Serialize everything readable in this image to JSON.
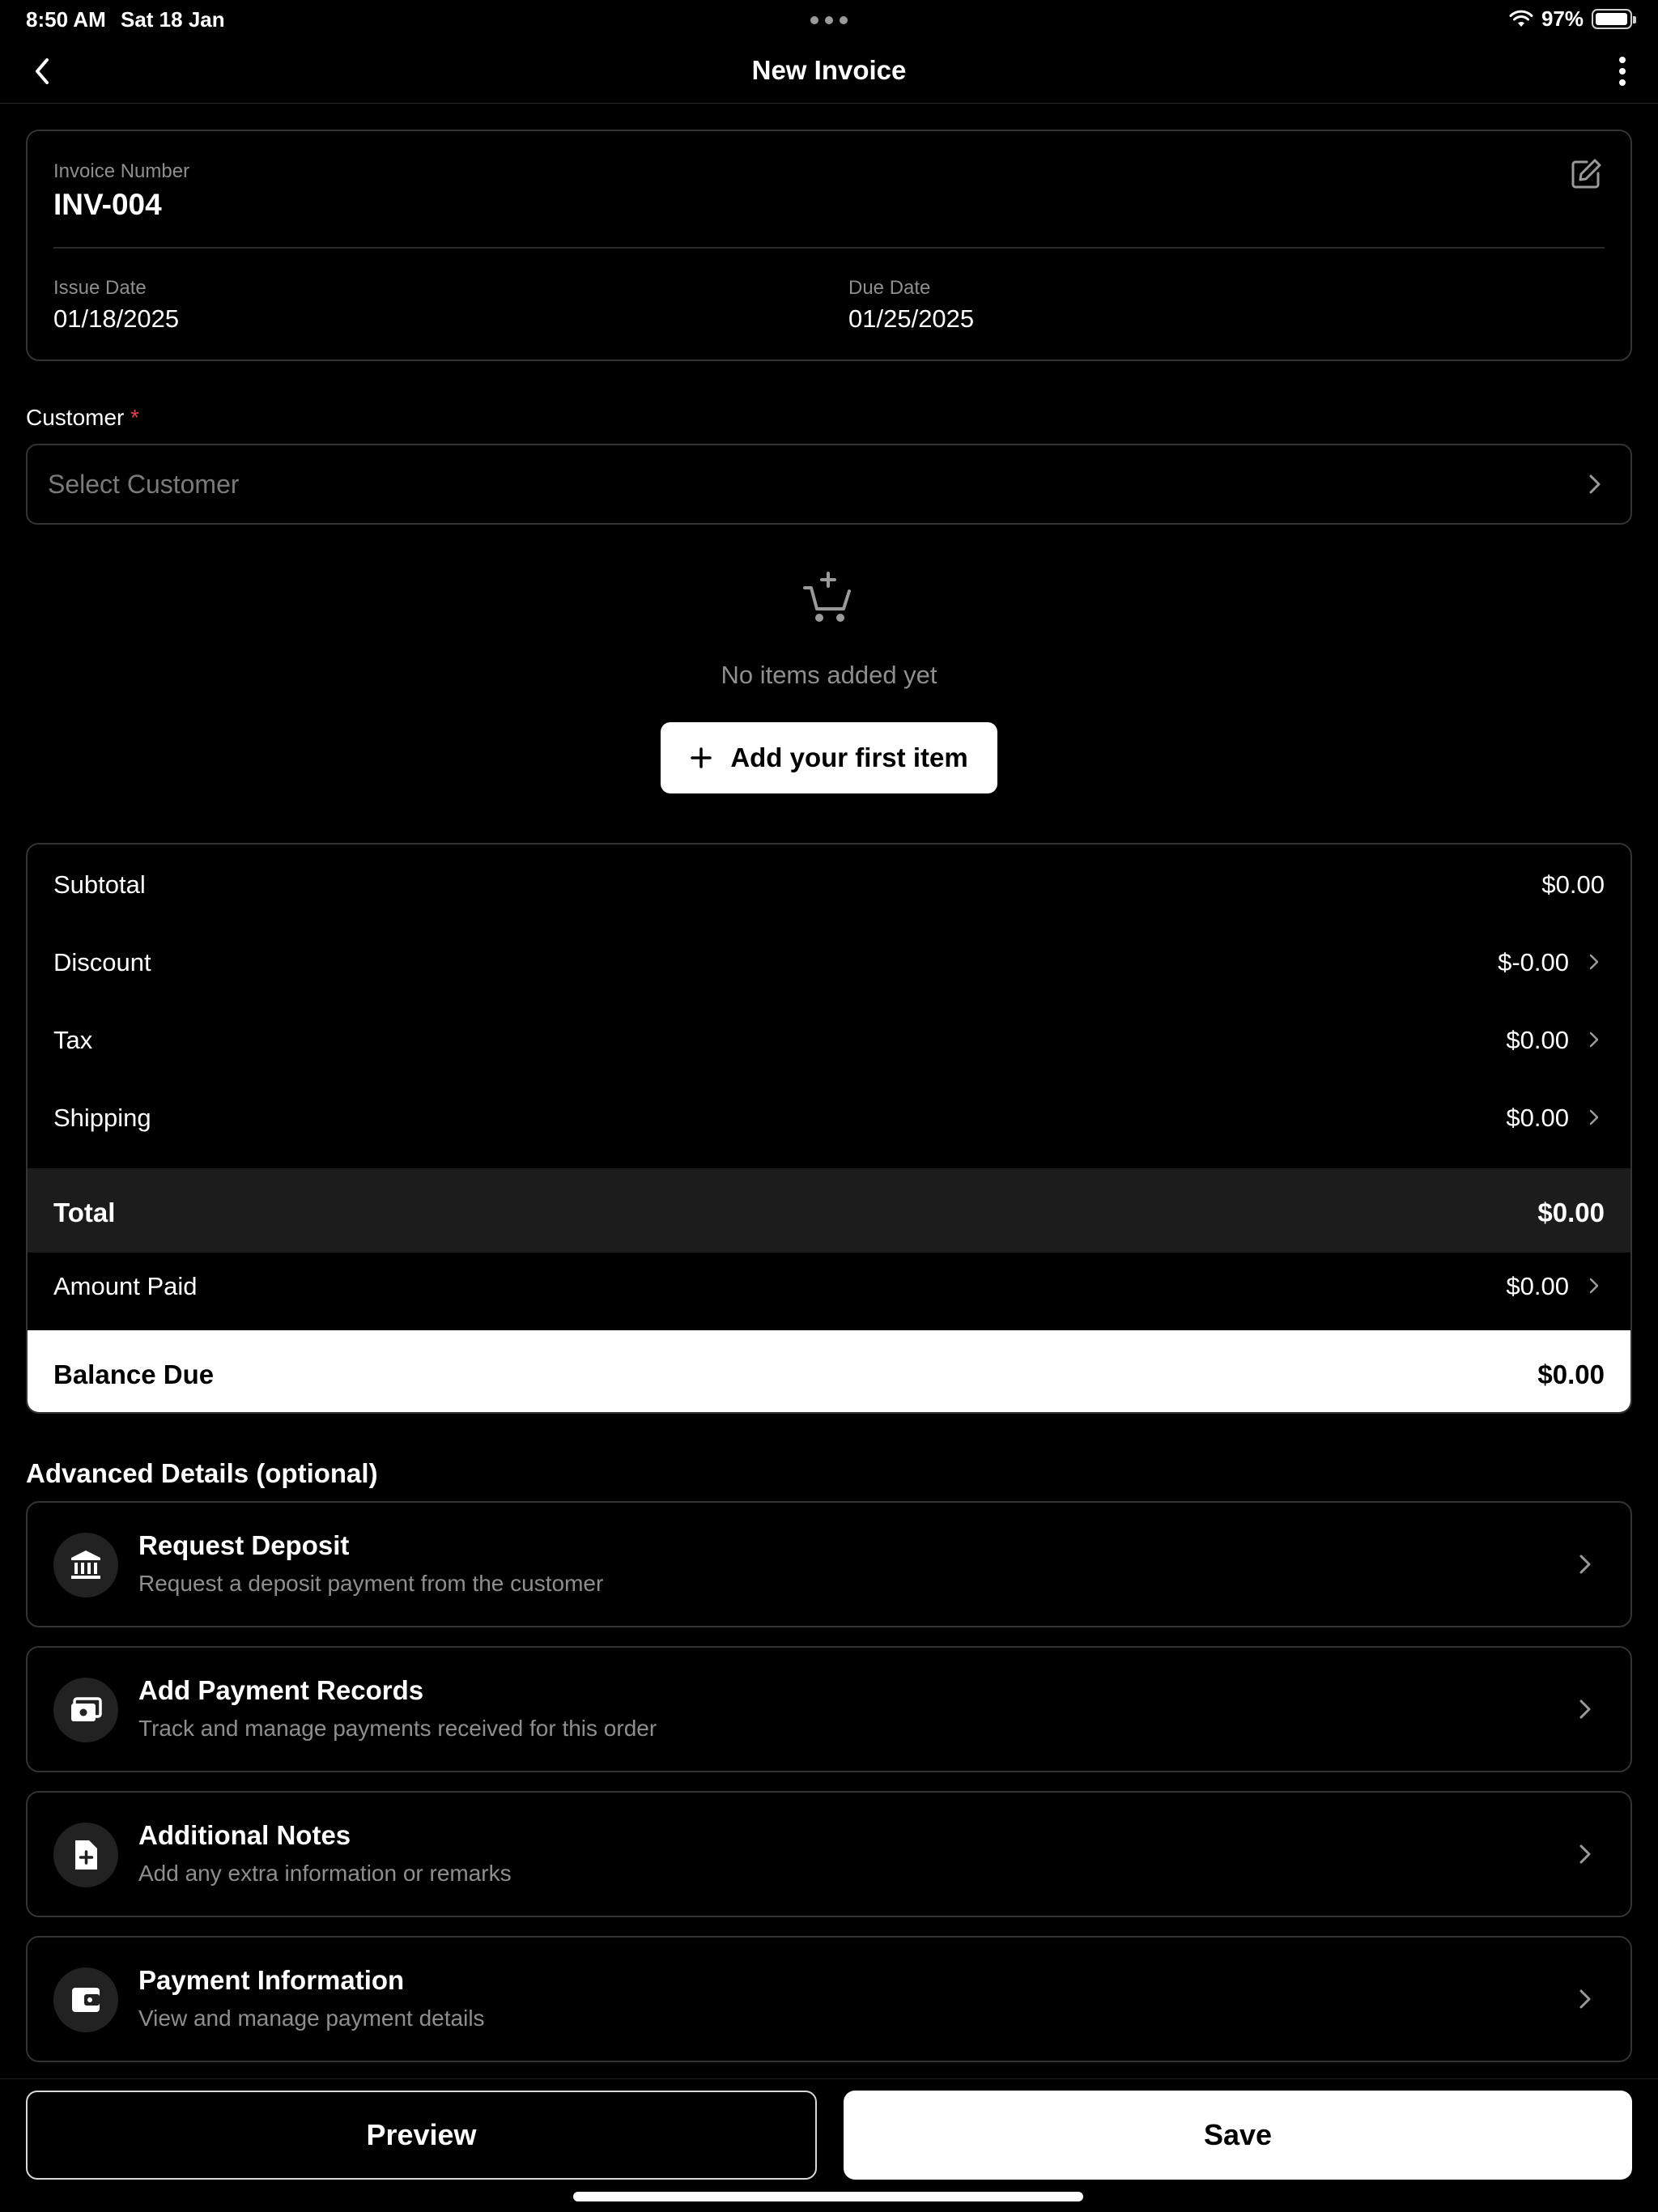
{
  "status_bar": {
    "time": "8:50 AM",
    "date": "Sat 18 Jan",
    "battery": "97%",
    "battery_level": 0.97
  },
  "nav": {
    "title": "New Invoice"
  },
  "invoice": {
    "number_label": "Invoice Number",
    "number": "INV-004",
    "issue_date_label": "Issue Date",
    "issue_date": "01/18/2025",
    "due_date_label": "Due Date",
    "due_date": "01/25/2025"
  },
  "customer": {
    "label": "Customer",
    "required_mark": "*",
    "placeholder": "Select Customer"
  },
  "items": {
    "empty_text": "No items added yet",
    "add_button_label": "Add your first item"
  },
  "totals": {
    "subtotal_label": "Subtotal",
    "subtotal": "$0.00",
    "discount_label": "Discount",
    "discount": "$-0.00",
    "tax_label": "Tax",
    "tax": "$0.00",
    "shipping_label": "Shipping",
    "shipping": "$0.00",
    "total_label": "Total",
    "total": "$0.00",
    "amount_paid_label": "Amount Paid",
    "amount_paid": "$0.00",
    "balance_due_label": "Balance Due",
    "balance_due": "$0.00"
  },
  "advanced": {
    "title": "Advanced Details (optional)",
    "items": [
      {
        "title": "Request Deposit",
        "description": "Request a deposit payment from the customer",
        "icon": "bank-icon"
      },
      {
        "title": "Add Payment Records",
        "description": "Track and manage payments received for this order",
        "icon": "cash-icon"
      },
      {
        "title": "Additional Notes",
        "description": "Add any extra information or remarks",
        "icon": "note-add-icon"
      },
      {
        "title": "Payment Information",
        "description": "View and manage payment details",
        "icon": "wallet-icon"
      }
    ]
  },
  "actions": {
    "preview_label": "Preview",
    "save_label": "Save"
  },
  "colors": {
    "background": "#000000",
    "card_border": "#333333",
    "required": "#e0464c",
    "total_row": "#1c1c1c"
  }
}
